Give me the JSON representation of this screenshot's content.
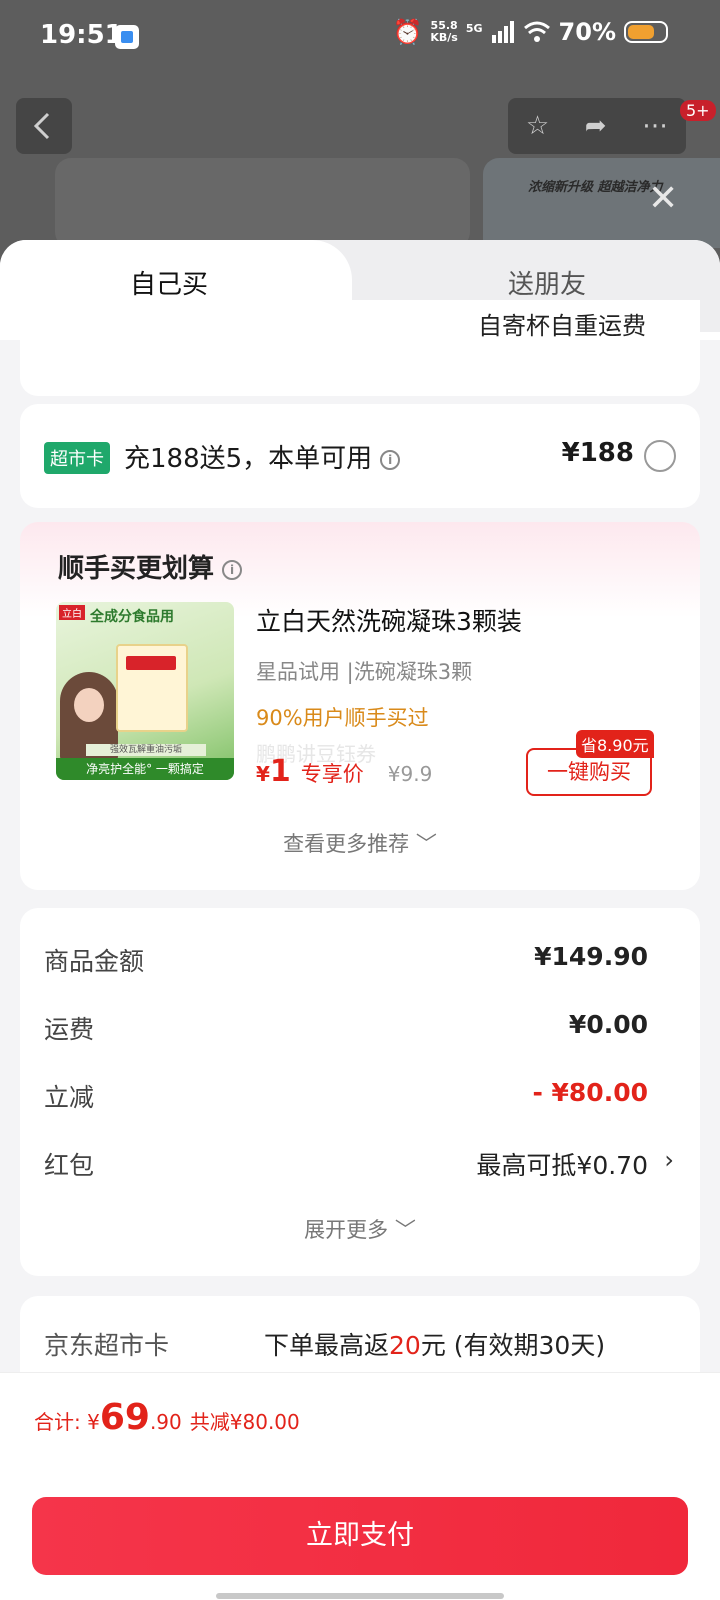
{
  "status_bar": {
    "time": "19:51",
    "net_speed_value": "55.8",
    "net_speed_unit": "KB/s",
    "network": "5G",
    "battery": "70%"
  },
  "background": {
    "badge": "5+",
    "banner_text": "浓缩新升级 超越洁净力"
  },
  "tabs": {
    "self": "自己买",
    "friend": "送朋友"
  },
  "clipped_card_text": "自寄杯自重运费",
  "supermarket_card": {
    "tag": "超市卡",
    "text": "充188送5，本单可用",
    "price": "¥188"
  },
  "recommend": {
    "title": "顺手买更划算",
    "product_name": "立白天然洗碗凝珠3颗装",
    "subtitle": "星品试用 |洗碗凝珠3颗",
    "buyers": "90%用户顺手买过",
    "watermark": "鹏鹏讲豆钰券",
    "price_yen": "¥",
    "price": "1",
    "price_label": "专享价",
    "old_price": "¥9.9",
    "save_badge": "省8.90元",
    "buy_button": "一键购买",
    "more": "查看更多推荐 ﹀",
    "image": {
      "brand": "立白",
      "headline": "全成分食品用",
      "bottom_text": "净亮护全能° 一颗搞定",
      "strip_text": "强效瓦解重油污垢"
    }
  },
  "summary": {
    "rows": [
      {
        "label": "商品金额",
        "value": "¥149.90"
      },
      {
        "label": "运费",
        "value": "¥0.00"
      },
      {
        "label": "立减",
        "value": "- ¥80.00"
      },
      {
        "label": "红包",
        "value": "最高可抵¥0.70"
      }
    ],
    "expand": "展开更多 ﹀"
  },
  "jd_card": {
    "label": "京东超市卡",
    "prefix": "下单最高返",
    "amount": "20",
    "suffix": "元 (有效期30天)"
  },
  "footer": {
    "total_label": "合计: ",
    "yen": "¥",
    "total_int": "69",
    "total_dec": ".90",
    "reduced": "共减¥80.00",
    "pay_button": "立即支付"
  },
  "colors": {
    "accent_red": "#e2231a",
    "pay_button": "#f0283b",
    "tag_green": "#1fa86b",
    "buyers_orange": "#d98a1a"
  }
}
